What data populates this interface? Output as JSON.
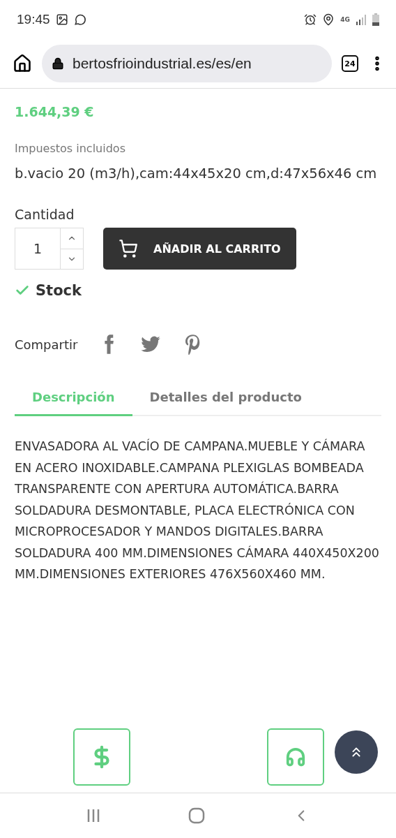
{
  "status_bar": {
    "time": "19:45",
    "network": "4G"
  },
  "browser": {
    "url": "bertosfrioindustrial.es/es/en",
    "tab_count": "24"
  },
  "product": {
    "price": "1.644,39 €",
    "tax_note": "Impuestos incluidos",
    "summary": "b.vacio 20 (m3/h),cam:44x45x20 cm,d:47x56x46 cm",
    "quantity_label": "Cantidad",
    "quantity": "1",
    "add_to_cart": "AÑADIR AL CARRITO",
    "availability": "Stock",
    "in_stock": true,
    "share_label": "Compartir"
  },
  "tabs": [
    {
      "label": "Descripción",
      "selected": true
    },
    {
      "label": "Detalles del producto",
      "selected": false
    }
  ],
  "description": "ENVASADORA AL VACÍO DE CAMPANA.MUEBLE Y CÁMARA EN ACERO INOXIDABLE.CAMPANA PLEXIGLAS BOMBEADA TRANSPARENTE CON APERTURA AUTOMÁTICA.BARRA SOLDADURA DESMONTABLE, PLACA ELECTRÓNICA CON MICROPROCESADOR Y MANDOS DIGITALES.BARRA SOLDADURA 400 MM.DIMENSIONES CÁMARA 440X450X200 MM.DIMENSIONES EXTERIORES 476X560X460 MM.",
  "bottom_buttons": [
    {
      "kind": "price"
    },
    {
      "kind": "support"
    }
  ]
}
